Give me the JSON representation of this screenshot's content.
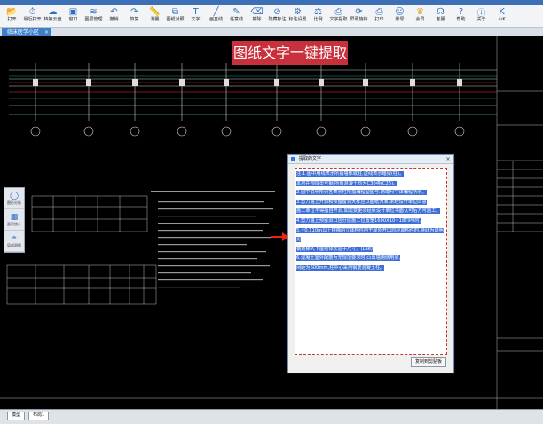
{
  "toolbar": {
    "items": [
      {
        "label": "打开",
        "icon": "folder-open-icon"
      },
      {
        "label": "最近打开",
        "icon": "clock-icon"
      },
      {
        "label": "转换云盘",
        "icon": "cloud-icon"
      },
      {
        "label": "窗口",
        "icon": "window-icon"
      },
      {
        "label": "图层管理",
        "icon": "layers-icon"
      },
      {
        "label": "撤销",
        "icon": "undo-icon"
      },
      {
        "label": "恢复",
        "icon": "redo-icon"
      },
      {
        "label": "测量",
        "icon": "ruler-icon"
      },
      {
        "label": "图纸对照",
        "icon": "compare-icon"
      },
      {
        "label": "文字",
        "icon": "text-icon"
      },
      {
        "label": "画直线",
        "icon": "line-icon"
      },
      {
        "label": "任意线",
        "icon": "pencil-icon"
      },
      {
        "label": "擦除",
        "icon": "eraser-icon"
      },
      {
        "label": "隐藏标注",
        "icon": "hide-icon"
      },
      {
        "label": "标注设置",
        "icon": "settings-icon"
      },
      {
        "label": "比例",
        "icon": "scale-icon"
      },
      {
        "label": "文字提取",
        "icon": "extract-icon"
      },
      {
        "label": "屏幕旋转",
        "icon": "rotate-icon"
      },
      {
        "label": "打印",
        "icon": "printer-icon"
      },
      {
        "label": "账号",
        "icon": "user-icon"
      },
      {
        "label": "会员",
        "icon": "crown-icon"
      },
      {
        "label": "客服",
        "icon": "headset-icon"
      },
      {
        "label": "帮助",
        "icon": "help-icon"
      },
      {
        "label": "关于",
        "icon": "info-icon"
      },
      {
        "label": "小K",
        "icon": "k-icon"
      }
    ]
  },
  "document_tab": {
    "label": "临床医学小区",
    "close": "×"
  },
  "banner": {
    "text": "图纸文字一键提取"
  },
  "side_panel": [
    {
      "label": "图形分析",
      "icon": "circle-icon"
    },
    {
      "label": "面积统计",
      "icon": "area-icon"
    },
    {
      "label": "局部测量",
      "icon": "measure-icon"
    }
  ],
  "dialog": {
    "title": "提取的文字",
    "close": "×",
    "lines": [
      "注:1.图中用线表示所指墙体或柱,虚线表示暗梁(柱)。",
      "本层在预埋型号钢,所有混凝土均为C30强(C25)。",
      "2.图中说明所列各表示柱所指编程型图号,两端尺寸详编程所示。",
      "3.剪力墙上开洞和预留留洞大样应以图纸为准,未经设计单位同意",
      "施工单位不得擅自开洞,如需变更须经原设计单位书面认可后方可施工。",
      "4.剪力墙上预留洞口应分层施工位置宽1600X10~18TIP0时,",
      "5.~0.110m以上楼梯的立体构件用于屋外开口均应成构件时,特此为说明见",
      "钢筋梯入下屋楼体长层子尺寸。(Lae)",
      "6.混凝土室外配筋为无规范要求时,凸出墙两侧用梁,",
      "间距为600mm,柱中心采用钢筋混凝土柱。"
    ],
    "button": "复制到剪贴板"
  },
  "bottom_tabs": [
    "模型",
    "布局1"
  ]
}
